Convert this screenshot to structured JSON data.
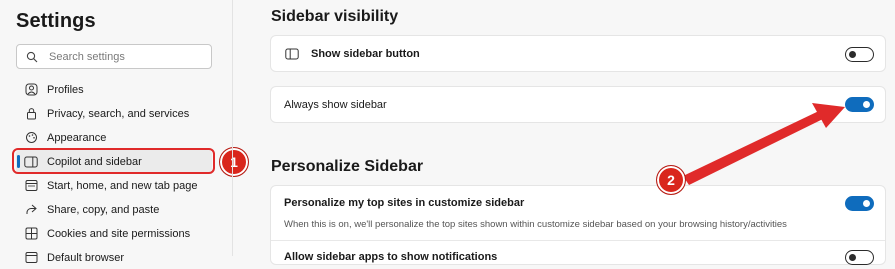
{
  "sidebar": {
    "title": "Settings",
    "search_placeholder": "Search settings",
    "items": [
      {
        "label": "Profiles",
        "icon": "profile-icon"
      },
      {
        "label": "Privacy, search, and services",
        "icon": "lock-icon"
      },
      {
        "label": "Appearance",
        "icon": "appearance-icon"
      },
      {
        "label": "Copilot and sidebar",
        "icon": "sidebar-icon",
        "active": true
      },
      {
        "label": "Start, home, and new tab page",
        "icon": "home-icon"
      },
      {
        "label": "Share, copy, and paste",
        "icon": "share-icon"
      },
      {
        "label": "Cookies and site permissions",
        "icon": "cookies-icon"
      },
      {
        "label": "Default browser",
        "icon": "browser-icon"
      }
    ]
  },
  "main": {
    "visibility": {
      "title": "Sidebar visibility",
      "show_button_label": "Show sidebar button",
      "show_button_on": false,
      "always_show_label": "Always show sidebar",
      "always_show_on": true
    },
    "personalize": {
      "title": "Personalize Sidebar",
      "top_sites_label": "Personalize my top sites in customize sidebar",
      "top_sites_desc": "When this is on, we'll personalize the top sites shown within customize sidebar based on your browsing history/activities",
      "top_sites_on": true,
      "next_row_label": "Allow sidebar apps to show notifications",
      "next_row_on": false
    }
  },
  "annotations": {
    "badge_1": "1",
    "badge_2": "2"
  },
  "colors": {
    "accent": "#0f6cbd",
    "annotation_red": "#e02a2a"
  }
}
